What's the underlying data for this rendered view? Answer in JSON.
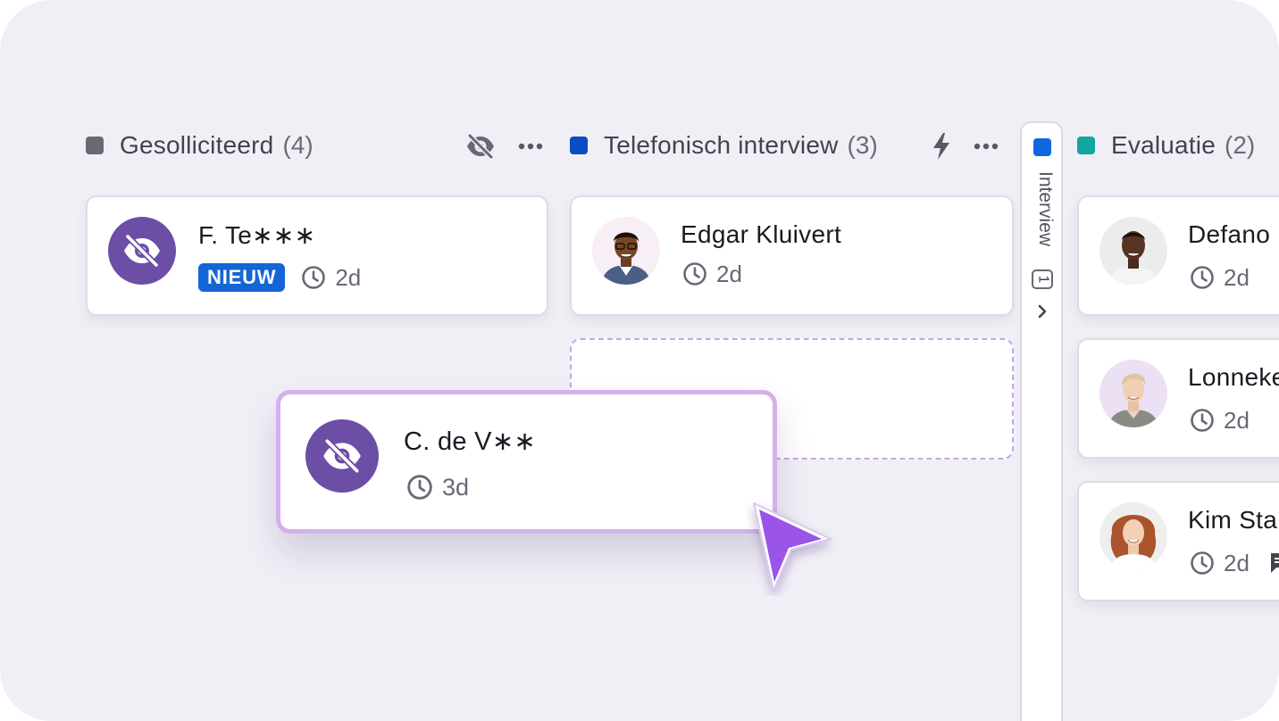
{
  "colors": {
    "board_bg": "#f1eff6",
    "applied_swatch": "#6b6873",
    "phone_swatch": "#0b4bc4",
    "interview_swatch": "#1166e0",
    "evaluation_swatch": "#12a6a0",
    "hidden_avatar": "#6d4ea6",
    "badge": "#1466d6",
    "cursor": "#9a55e6"
  },
  "columns": {
    "applied": {
      "title": "Gesolliciteerd",
      "count": "(4)",
      "icons": [
        "eye-off-icon",
        "more-icon"
      ],
      "cards": [
        {
          "name": "F. Te∗∗∗",
          "badge": "NIEUW",
          "age": "2d",
          "avatar": "hidden-candidate-icon"
        }
      ]
    },
    "phone": {
      "title": "Telefonisch interview",
      "count": "(3)",
      "icons": [
        "lightning-icon",
        "more-icon"
      ],
      "cards": [
        {
          "name": "Edgar Kluivert",
          "age": "2d",
          "avatar": "photo"
        }
      ]
    },
    "interview": {
      "title": "Interview",
      "count": "1",
      "collapsed": true,
      "icons": [
        "chevron-right-icon"
      ]
    },
    "evaluation": {
      "title": "Evaluatie",
      "count": "(2)",
      "cards": [
        {
          "name": "Defano",
          "age": "2d",
          "avatar": "photo"
        },
        {
          "name": "Lonneke",
          "age": "2d",
          "avatar": "photo"
        },
        {
          "name": "Kim Sta",
          "age": "2d",
          "avatar": "photo",
          "extra_icon": "comment-icon"
        }
      ]
    }
  },
  "dragging": {
    "name": "C. de V∗∗",
    "age": "3d",
    "avatar": "hidden-candidate-icon",
    "cursor_icon": "pointer-arrow-icon"
  }
}
